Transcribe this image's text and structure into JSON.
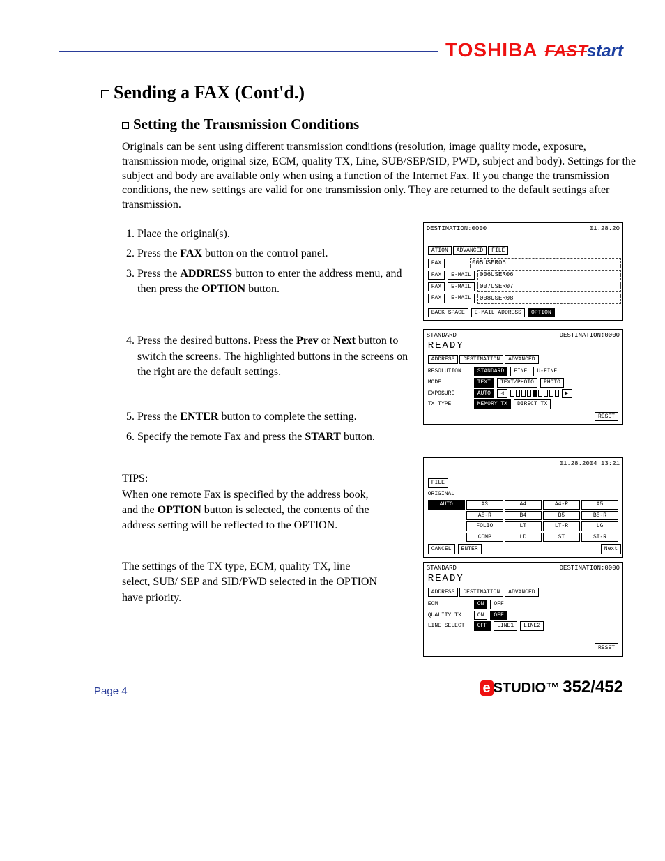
{
  "header": {
    "brand": "TOSHIBA",
    "fast": "FAST",
    "start": "start"
  },
  "title": "Sending a FAX (Cont'd.)",
  "subtitle": "Setting the Transmission Conditions",
  "intro": "Originals can be sent using different transmission conditions (resolution, image quality mode, exposure, transmission mode, original size, ECM, quality TX, Line, SUB/SEP/SID, PWD, subject and body). Settings for the subject and body are available only when using a function of the Internet Fax. If you change the transmission conditions, the new settings are valid for one transmission only. They are returned to the default settings after transmission.",
  "steps": {
    "s1": "Place the original(s).",
    "s2_a": "Press the ",
    "s2_b": "FAX",
    "s2_c": " button on the control panel.",
    "s3_a": "Press the ",
    "s3_b": "ADDRESS",
    "s3_c": " button to enter the address menu, and then press the ",
    "s3_d": "OPTION",
    "s3_e": " button.",
    "s4_a": "Press the desired buttons. Press the ",
    "s4_b": "Prev",
    "s4_c": " or ",
    "s4_d": "Next",
    "s4_e": " button to switch the screens. The highlighted buttons in the screens on the right are the default settings.",
    "s5_a": "Press the ",
    "s5_b": "ENTER",
    "s5_c": " button to complete the setting.",
    "s6_a": "Specify the remote Fax and press the ",
    "s6_b": "START",
    "s6_c": " button."
  },
  "tips": {
    "label": "TIPS:",
    "p1_a": "When one remote Fax is specified by the address book, and the ",
    "p1_b": "OPTION",
    "p1_c": " button is selected, the contents of the address setting will be reflected to the OPTION.",
    "p2": "The settings of the TX type, ECM, quality TX, line select, SUB/ SEP and SID/PWD selected in the OPTION have priority."
  },
  "screen1": {
    "dest": "DESTINATION:0000",
    "date": "01.28.20",
    "tab1": "ATION",
    "tab2": "ADVANCED",
    "tab3": "FILE",
    "fax": "FAX",
    "email": "E-MAIL",
    "u5": "005USER05",
    "u6": "006USER06",
    "u7": "007USER07",
    "u8": "008USER08",
    "back": "BACK SPACE",
    "emaddr": "E-MAIL ADDRESS",
    "option": "OPTION"
  },
  "screen2": {
    "std": "STANDARD",
    "dest": "DESTINATION:0000",
    "ready": "READY",
    "tab1": "ADDRESS",
    "tab2": "DESTINATION",
    "tab3": "ADVANCED",
    "l_res": "RESOLUTION",
    "l_mode": "MODE",
    "l_exp": "EXPOSURE",
    "l_tx": "TX TYPE",
    "standard": "STANDARD",
    "fine": "FINE",
    "ufine": "U-FINE",
    "text": "TEXT",
    "tp": "TEXT/PHOTO",
    "photo": "PHOTO",
    "auto": "AUTO",
    "memtx": "MEMORY TX",
    "dirtx": "DIRECT TX",
    "reset": "RESET"
  },
  "screen3": {
    "date": "01.28.2004 13:21",
    "tab1": "FILE",
    "orig": "ORIGINAL",
    "sizes": [
      "AUTO",
      "A3",
      "A4",
      "A4-R",
      "A5",
      "",
      "A5-R",
      "B4",
      "B5",
      "B5-R",
      "",
      "FOLIO",
      "LT",
      "LT-R",
      "LG",
      "",
      "COMP",
      "LD",
      "ST",
      "ST-R"
    ],
    "cancel": "CANCEL",
    "enter": "ENTER",
    "next": "Next"
  },
  "screen4": {
    "std": "STANDARD",
    "dest": "DESTINATION:0000",
    "ready": "READY",
    "tab1": "ADDRESS",
    "tab2": "DESTINATION",
    "tab3": "ADVANCED",
    "l_ecm": "ECM",
    "l_qtx": "QUALITY TX",
    "l_line": "LINE SELECT",
    "on": "ON",
    "off": "OFF",
    "line1": "LINE1",
    "line2": "LINE2",
    "reset": "RESET"
  },
  "footer": {
    "page": "Page 4",
    "e": "e",
    "studio": "STUDIO™",
    "model": "352/452"
  }
}
